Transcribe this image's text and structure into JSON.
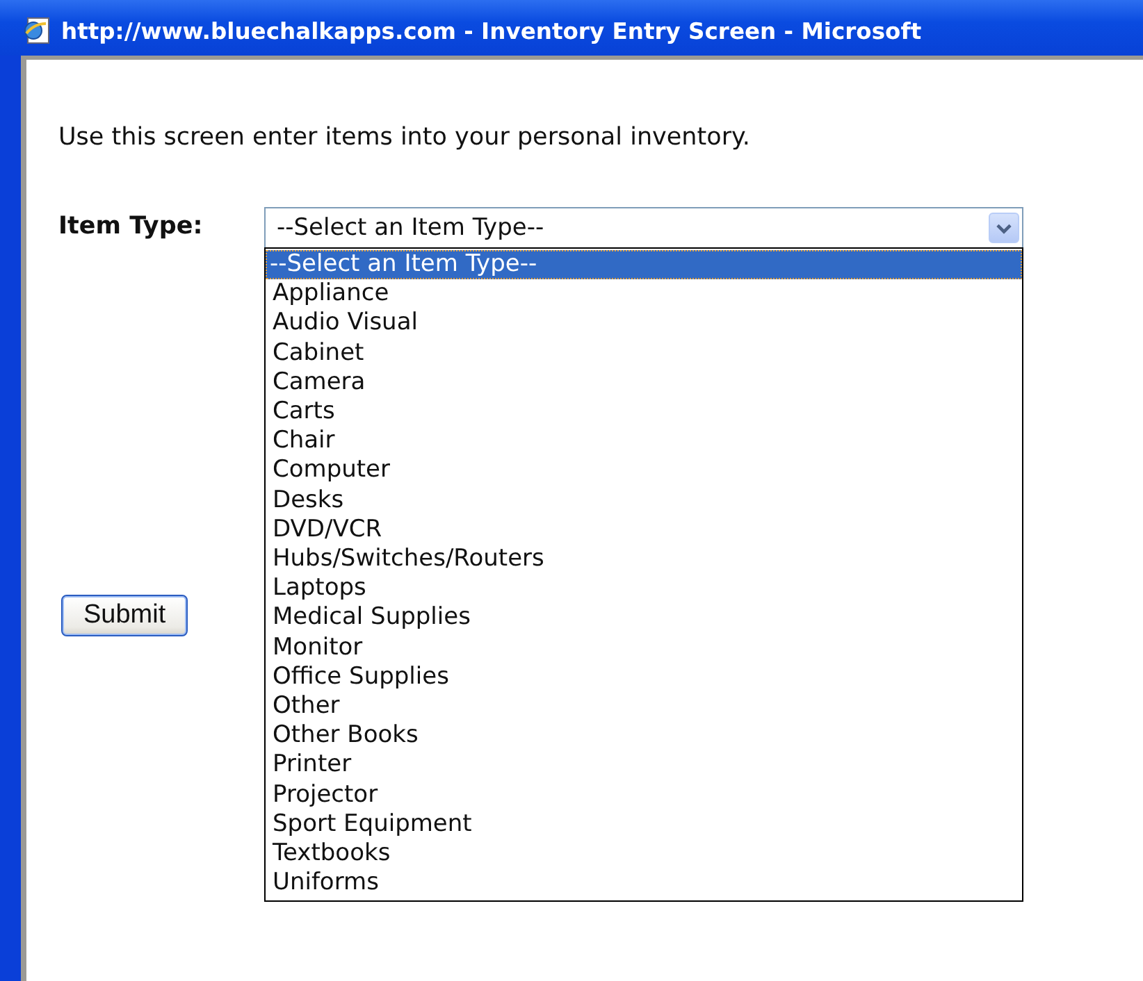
{
  "window": {
    "title": "http://www.bluechalkapps.com - Inventory Entry Screen - Microsoft"
  },
  "intro": "Use this screen enter items into your personal inventory.",
  "item_type": {
    "label": "Item Type:",
    "value": "--Select an Item Type--",
    "expanded": true,
    "options": [
      {
        "label": "--Select an Item Type--",
        "selected": true
      },
      {
        "label": "Appliance",
        "selected": false
      },
      {
        "label": "Audio Visual",
        "selected": false
      },
      {
        "label": "Cabinet",
        "selected": false
      },
      {
        "label": "Camera",
        "selected": false
      },
      {
        "label": "Carts",
        "selected": false
      },
      {
        "label": "Chair",
        "selected": false
      },
      {
        "label": "Computer",
        "selected": false
      },
      {
        "label": "Desks",
        "selected": false
      },
      {
        "label": "DVD/VCR",
        "selected": false
      },
      {
        "label": "Hubs/Switches/Routers",
        "selected": false
      },
      {
        "label": "Laptops",
        "selected": false
      },
      {
        "label": "Medical Supplies",
        "selected": false
      },
      {
        "label": "Monitor",
        "selected": false
      },
      {
        "label": "Office Supplies",
        "selected": false
      },
      {
        "label": "Other",
        "selected": false
      },
      {
        "label": "Other Books",
        "selected": false
      },
      {
        "label": "Printer",
        "selected": false
      },
      {
        "label": "Projector",
        "selected": false
      },
      {
        "label": "Sport Equipment",
        "selected": false
      },
      {
        "label": "Textbooks",
        "selected": false
      },
      {
        "label": "Uniforms",
        "selected": false
      }
    ]
  },
  "submit_button": "Submit"
}
